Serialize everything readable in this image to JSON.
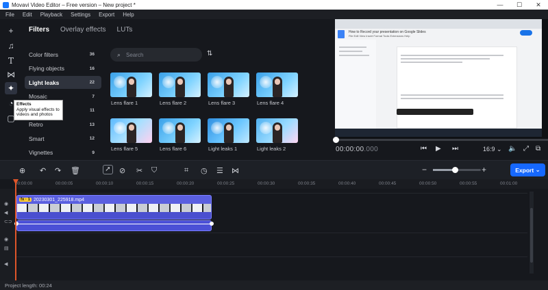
{
  "window": {
    "title": "Movavi Video Editor – Free version – New project *",
    "minimize": "—",
    "maximize": "☐",
    "close": "✕"
  },
  "menu": [
    "File",
    "Edit",
    "Playback",
    "Settings",
    "Export",
    "Help"
  ],
  "tabs": [
    {
      "label": "Filters",
      "active": true
    },
    {
      "label": "Overlay effects",
      "active": false
    },
    {
      "label": "LUTs",
      "active": false
    }
  ],
  "tooltip": {
    "title": "Effects",
    "body": "Apply visual effects to videos and photos"
  },
  "categories": [
    {
      "label": "Color filters",
      "count": "36"
    },
    {
      "label": "Flying objects",
      "count": "16"
    },
    {
      "label": "Light leaks",
      "count": "22",
      "active": true
    },
    {
      "label": "Mosaic",
      "count": "7"
    },
    {
      "label": "",
      "count": "11"
    },
    {
      "label": "Retro",
      "count": "13"
    },
    {
      "label": "Smart",
      "count": "12"
    },
    {
      "label": "Vignettes",
      "count": "9"
    }
  ],
  "search": {
    "placeholder": "Search"
  },
  "effects": [
    {
      "label": "Lens flare 1"
    },
    {
      "label": "Lens flare 2"
    },
    {
      "label": "Lens flare 3"
    },
    {
      "label": "Lens flare 4"
    },
    {
      "label": "Lens flare 5"
    },
    {
      "label": "Lens flare 6"
    },
    {
      "label": "Light leaks 1"
    },
    {
      "label": "Light leaks 2"
    }
  ],
  "preview": {
    "doc_title": "How to Record your presentation on Google Slides",
    "doc_menu": "File  Edit  View  Insert  Format  Tools  Extensions  Help",
    "timecode": "00:00:00",
    "timecode_ms": ".000",
    "aspect": "16:9",
    "playback_position": 0
  },
  "timeline": {
    "ruler": [
      "00:00:00",
      "00:00:05",
      "00:00:10",
      "00:00:15",
      "00:00:20",
      "00:00:25",
      "00:00:30",
      "00:00:35",
      "00:00:40",
      "00:00:45",
      "00:00:50",
      "00:00:55",
      "00:01:00"
    ],
    "clip_name": "20230301_225918.mp4",
    "clip_fx": "fx · 1",
    "export_label": "Export",
    "zoom_level": 0.45
  },
  "status": {
    "project_length": "Project length: 00:24"
  },
  "colors": {
    "accent": "#1668ff",
    "playhead": "#e0562a",
    "clip": "#5a5fe0"
  }
}
